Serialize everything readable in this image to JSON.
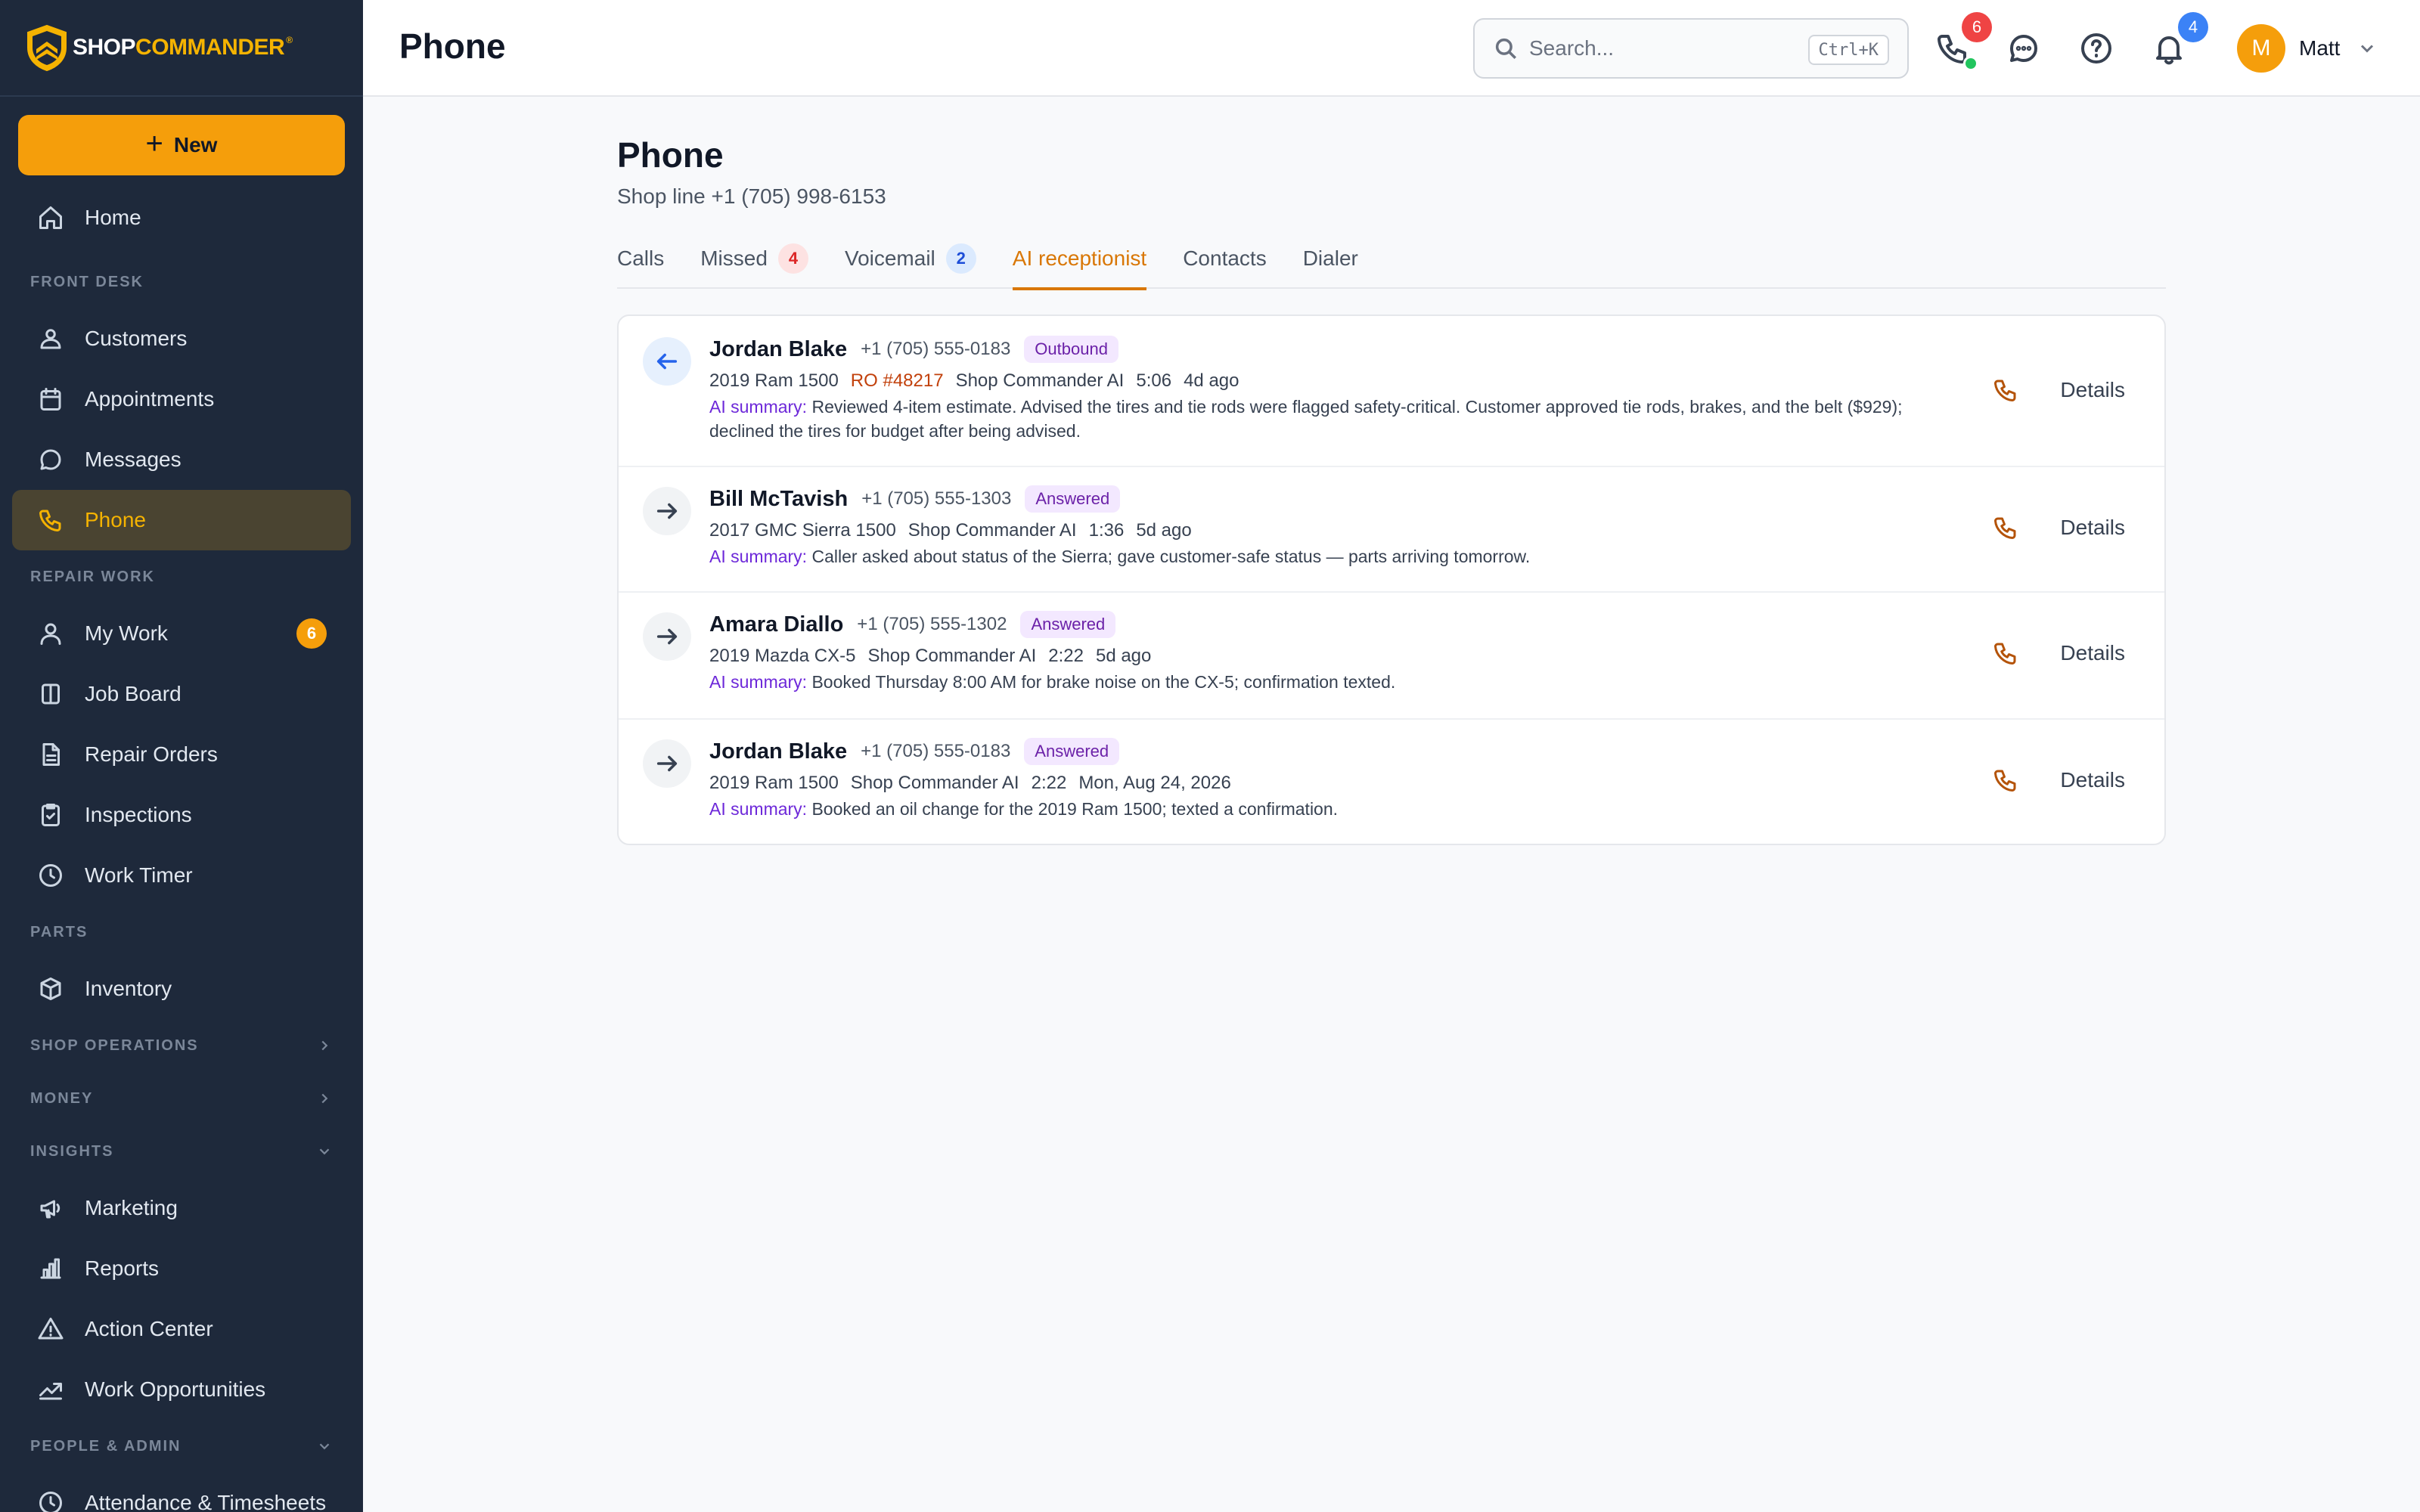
{
  "brand": {
    "name_part1": "SHOP",
    "name_part2": "COMMANDER",
    "reg": "®"
  },
  "sidebar": {
    "new_label": "New",
    "top_items": [
      {
        "label": "Home",
        "icon": "home-icon"
      }
    ],
    "sections": [
      {
        "label": "FRONT DESK",
        "items": [
          "Customers",
          "Appointments",
          "Messages",
          "Phone"
        ]
      },
      {
        "label": "REPAIR WORK",
        "items": [
          "My Work",
          "Job Board",
          "Repair Orders",
          "Inspections",
          "Work Timer"
        ],
        "my_work_badge": "6"
      },
      {
        "label": "PARTS",
        "items": [
          "Inventory"
        ]
      },
      {
        "label": "SHOP OPERATIONS"
      },
      {
        "label": "MONEY"
      },
      {
        "label": "INSIGHTS",
        "items": [
          "Marketing",
          "Reports",
          "Action Center",
          "Work Opportunities"
        ]
      },
      {
        "label": "PEOPLE & ADMIN",
        "items": [
          "Attendance & Timesheets"
        ]
      }
    ]
  },
  "header": {
    "title": "Phone",
    "search_placeholder": "Search...",
    "search_shortcut": "Ctrl+K",
    "phone_badge": "6",
    "notif_badge": "4",
    "user_initial": "M",
    "user_name": "Matt"
  },
  "page": {
    "title": "Phone",
    "subtitle": "Shop line +1 (705) 998-6153",
    "tabs": [
      {
        "label": "Calls"
      },
      {
        "label": "Missed",
        "badge": "4"
      },
      {
        "label": "Voicemail",
        "badge": "2"
      },
      {
        "label": "AI receptionist",
        "active": true
      },
      {
        "label": "Contacts"
      },
      {
        "label": "Dialer"
      }
    ]
  },
  "calls": [
    {
      "direction": "outbound",
      "name": "Jordan Blake",
      "phone": "+1 (705) 555-0183",
      "status": "Outbound",
      "vehicle": "2019 Ram 1500",
      "ro": "RO #48217",
      "agent": "Shop Commander AI",
      "duration": "5:06",
      "when": "4d ago",
      "summary_label": "AI summary:",
      "summary": "Reviewed 4-item estimate. Advised the tires and tie rods were flagged safety-critical. Customer approved tie rods, brakes, and the belt ($929); declined the tires for budget after being advised.",
      "details": "Details"
    },
    {
      "direction": "inbound",
      "name": "Bill McTavish",
      "phone": "+1 (705) 555-1303",
      "status": "Answered",
      "vehicle": "2017 GMC Sierra 1500",
      "agent": "Shop Commander AI",
      "duration": "1:36",
      "when": "5d ago",
      "summary_label": "AI summary:",
      "summary": "Caller asked about status of the Sierra; gave customer-safe status — parts arriving tomorrow.",
      "details": "Details"
    },
    {
      "direction": "inbound",
      "name": "Amara Diallo",
      "phone": "+1 (705) 555-1302",
      "status": "Answered",
      "vehicle": "2019 Mazda CX-5",
      "agent": "Shop Commander AI",
      "duration": "2:22",
      "when": "5d ago",
      "summary_label": "AI summary:",
      "summary": "Booked Thursday 8:00 AM for brake noise on the CX-5; confirmation texted.",
      "details": "Details"
    },
    {
      "direction": "inbound",
      "name": "Jordan Blake",
      "phone": "+1 (705) 555-0183",
      "status": "Answered",
      "vehicle": "2019 Ram 1500",
      "agent": "Shop Commander AI",
      "duration": "2:22",
      "when": "Mon, Aug 24, 2026",
      "summary_label": "AI summary:",
      "summary": "Booked an oil change for the 2019 Ram 1500; texted a confirmation.",
      "details": "Details"
    }
  ]
}
